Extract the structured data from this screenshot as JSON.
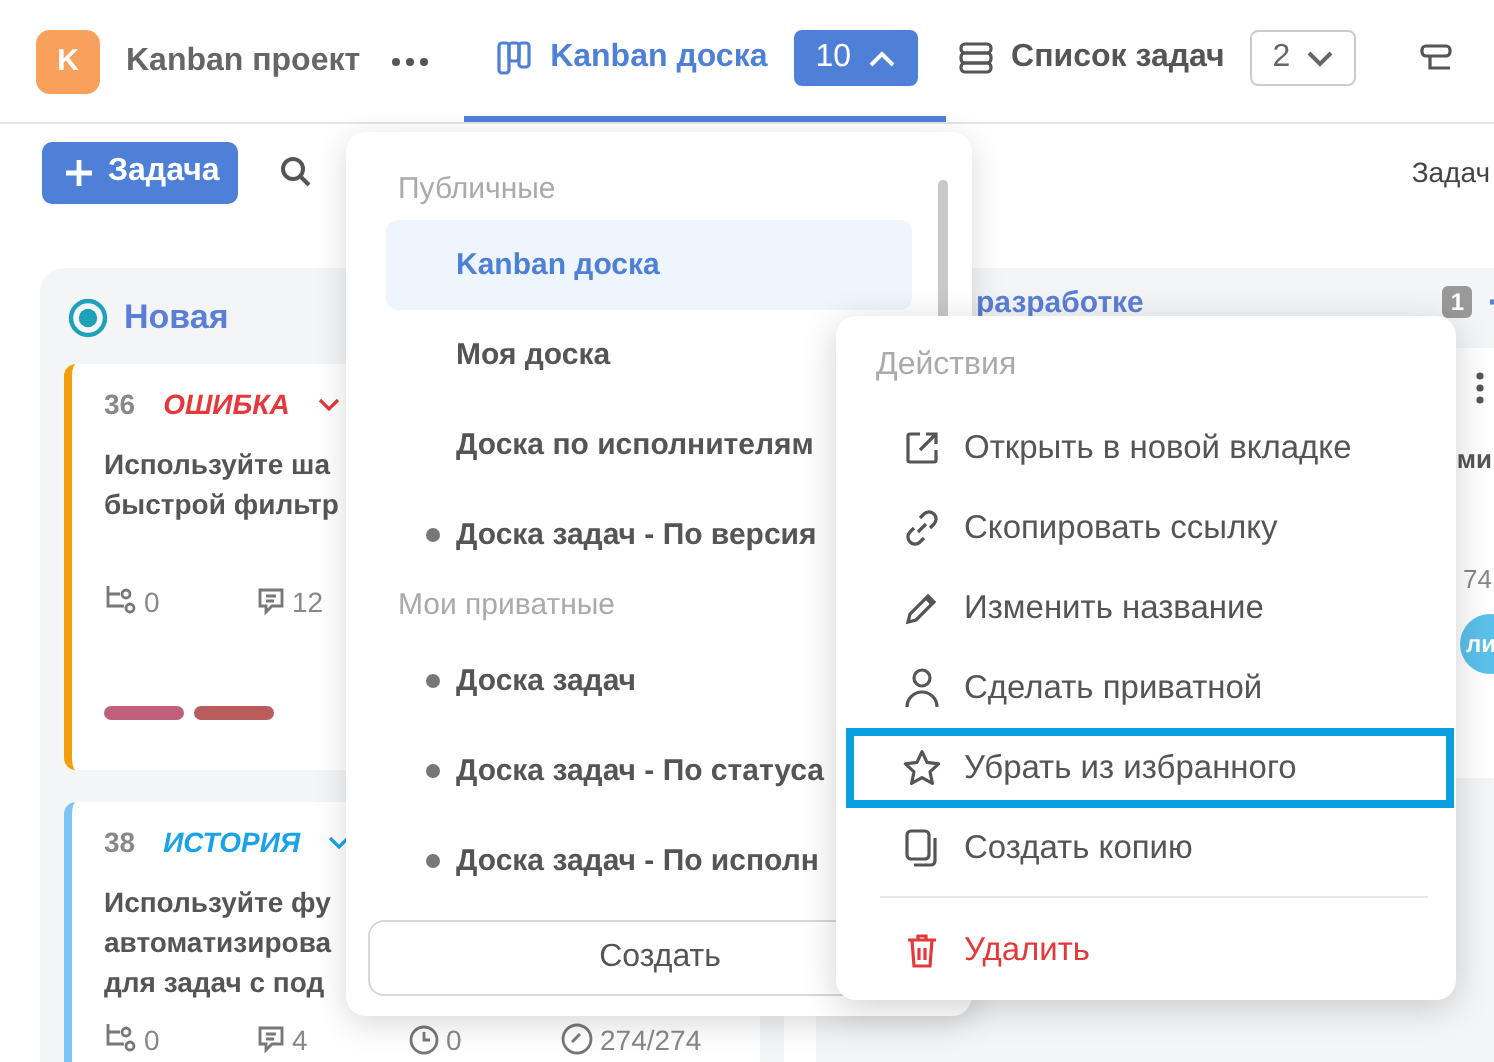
{
  "header": {
    "project": {
      "avatar": "K",
      "name": "Kanban проект"
    },
    "tabs": [
      {
        "kind": "board",
        "label": "Kanban доска",
        "count": "10",
        "selected": true,
        "expanded": true
      },
      {
        "kind": "list",
        "label": "Список задач",
        "count": "2",
        "selected": false,
        "expanded": false
      }
    ]
  },
  "toolbar": {
    "add_button": "Задача",
    "right_label": "Задач"
  },
  "columns": [
    {
      "title": "Новая",
      "cards": [
        {
          "id": "36",
          "type": "ОШИБКА",
          "kind": "bug",
          "color": "#f59e0b",
          "title": "Используйте ша быстрой фильтр",
          "subtasks": "0",
          "comments": "12",
          "tags": [
            {
              "color": "#c0607c"
            },
            {
              "color": "#b85c5c"
            }
          ]
        },
        {
          "id": "38",
          "type": "ИСТОРИЯ",
          "kind": "story",
          "color": "#7cc4f8",
          "title": "Используйте фу автоматизирова для задач с под",
          "subtasks": "0",
          "comments": "4",
          "time": "0",
          "estimate": "274/274"
        }
      ]
    },
    {
      "title": "разработке",
      "count": "1",
      "cards": [
        {
          "title": "ми",
          "estimate": "74",
          "avatar": "ли"
        }
      ]
    }
  ],
  "board_menu": {
    "sections": [
      {
        "title": "Публичные",
        "items": [
          {
            "label": "Kanban доска",
            "selected": true,
            "dot": false
          },
          {
            "label": "Моя доска",
            "selected": false,
            "dot": false
          },
          {
            "label": "Доска по исполнителям",
            "selected": false,
            "dot": false
          },
          {
            "label": "Доска задач - По версия",
            "selected": false,
            "dot": true
          }
        ]
      },
      {
        "title": "Мои приватные",
        "items": [
          {
            "label": "Доска задач",
            "selected": false,
            "dot": true
          },
          {
            "label": "Доска задач - По статуса",
            "selected": false,
            "dot": true
          },
          {
            "label": "Доска задач - По исполн",
            "selected": false,
            "dot": true
          }
        ]
      }
    ],
    "create_button": "Создать"
  },
  "context_menu": {
    "title": "Действия",
    "sections": [
      {
        "items": [
          {
            "kind": "open",
            "label": "Открыть в новой вкладке",
            "selected": false
          },
          {
            "kind": "link",
            "label": "Скопировать ссылку",
            "selected": false
          },
          {
            "kind": "rename",
            "label": "Изменить название",
            "selected": false
          },
          {
            "kind": "private",
            "label": "Сделать приватной",
            "selected": false
          },
          {
            "kind": "star",
            "label": "Убрать из избранного",
            "selected": true
          },
          {
            "kind": "copy",
            "label": "Создать копию",
            "selected": false
          }
        ]
      },
      {
        "items": [
          {
            "kind": "delete",
            "label": "Удалить",
            "selected": false
          }
        ]
      }
    ]
  }
}
